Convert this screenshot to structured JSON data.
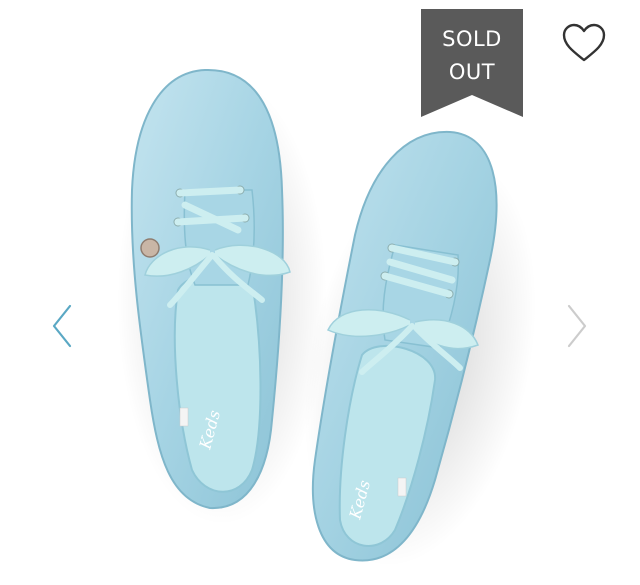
{
  "product": {
    "image_description_icon": "light-blue-glitter-sneakers-image",
    "status_badge": {
      "line1": "SOLD",
      "line2": "OUT",
      "color": "#5a5a5a"
    }
  },
  "carousel": {
    "prev_icon": "chevron-left-icon",
    "next_icon": "chevron-right-icon",
    "prev_color": "#5aa8c4",
    "next_color": "#cccccc"
  },
  "favorite": {
    "icon": "heart-icon"
  },
  "colors": {
    "shoe": "#a9d7e6",
    "shoe_shade": "#86c2d6",
    "insole": "#bfe6ec",
    "lace": "#cdeef0"
  }
}
